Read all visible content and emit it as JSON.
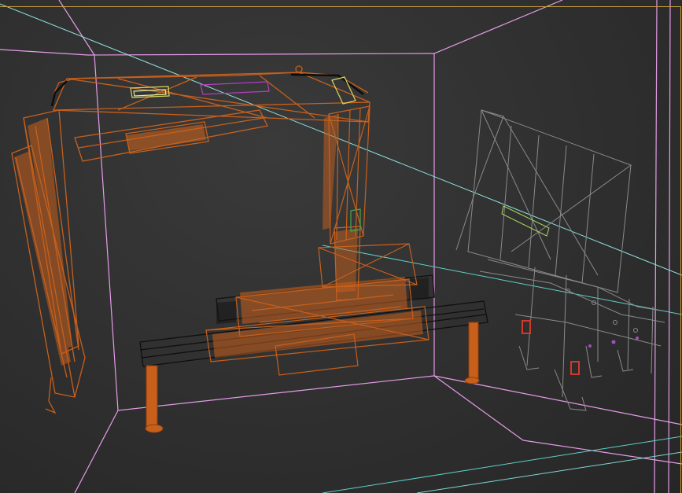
{
  "viewport": {
    "mode": "wireframe",
    "label": "",
    "colors": {
      "background": "#2e2e2e",
      "room_lines": "#e59ce8",
      "crane": "#c8601c",
      "crane_dark": "#8c3e0f",
      "bucket": "#8a8a8a",
      "bucket_dark": "#6a6a6a",
      "light_line": "#8fe3e0",
      "frame": "#c9a13c",
      "helper_yellow": "#d8d860",
      "helper_magenta": "#b040c0",
      "helper_green": "#48a848",
      "red_parts": "#d03a2a",
      "outrigger_beam": "#1a1a1a"
    },
    "objects": [
      "crane-boom",
      "crane-base",
      "outrigger-beam",
      "grab-bucket",
      "room-box"
    ],
    "icons": [
      "crane-wireframe-icon",
      "bucket-wireframe-icon"
    ]
  }
}
